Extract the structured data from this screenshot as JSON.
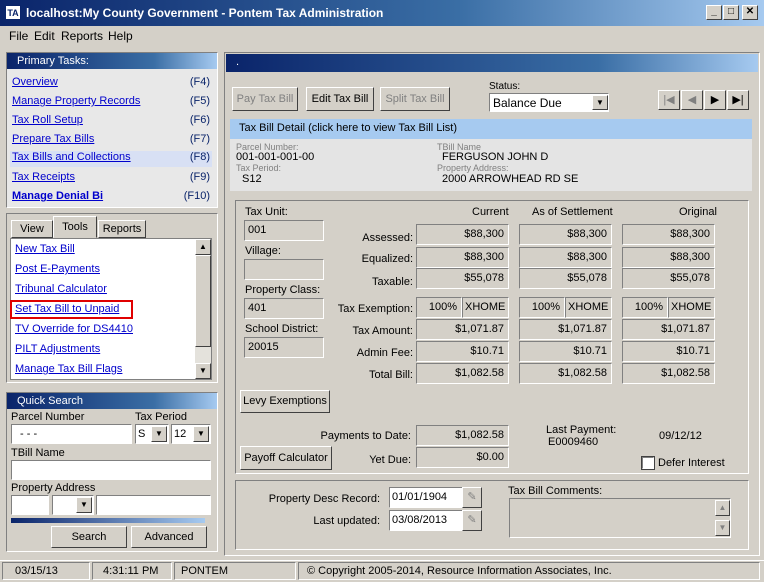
{
  "window": {
    "icon_text": "TA",
    "title": "localhost:My County Government - Pontem Tax Administration"
  },
  "menu": [
    "File",
    "Edit",
    "Reports",
    "Help"
  ],
  "primary_tasks": {
    "title": "Primary Tasks:",
    "items": [
      {
        "label": "Overview",
        "key": "(F4)"
      },
      {
        "label": "Manage Property Records",
        "key": "(F5)"
      },
      {
        "label": "Tax Roll Setup",
        "key": "(F6)"
      },
      {
        "label": "Prepare Tax Bills",
        "key": "(F7)"
      },
      {
        "label": "Tax Bills and Collections",
        "key": "(F8)"
      },
      {
        "label": "Tax Receipts",
        "key": "(F9)"
      },
      {
        "label": "Manage Denial Bi",
        "key": "(F10)"
      }
    ]
  },
  "tools_tabs": [
    "View",
    "Tools",
    "Reports"
  ],
  "tools_items": [
    "New Tax Bill",
    "Post E-Payments",
    "Tribunal Calculator",
    "Set Tax Bill to Unpaid",
    "TV Override for DS4410",
    "PILT Adjustments",
    "Manage Tax Bill Flags"
  ],
  "quick_search": {
    "title": "Quick Search",
    "parcel_label": "Parcel Number",
    "parcel_value": "-   -   -",
    "tax_period_label": "Tax Period",
    "tax_period_season": "S",
    "tax_period_year": "12",
    "tbill_name_label": "TBill Name",
    "property_address_label": "Property Address",
    "search_button": "Search",
    "advanced_button": "Advanced"
  },
  "status_bar": {
    "date": "03/15/13",
    "time": "4:31:11 PM",
    "user": "PONTEM",
    "copyright": "© Copyright 2005-2014, Resource Information Associates, Inc."
  },
  "right_panel": {
    "title": ".",
    "pay_button": "Pay Tax Bill",
    "edit_button": "Edit Tax Bill",
    "split_button": "Split Tax Bill",
    "status_label": "Status:",
    "status_value": "Balance Due",
    "detail_header": "Tax Bill Detail (click here to view Tax Bill List)",
    "parcel_number_label": "Parcel Number:",
    "parcel_number": "001-001-001-00",
    "tax_period_label": "Tax Period:",
    "tax_period": "S12",
    "tbill_name_label": "TBill Name",
    "tbill_name": "FERGUSON JOHN D",
    "property_address_label": "Property Address:",
    "property_address": "2000 ARROWHEAD RD SE"
  },
  "detail": {
    "tax_unit_label": "Tax Unit:",
    "tax_unit": "001",
    "village_label": "Village:",
    "village": "",
    "property_class_label": "Property Class:",
    "property_class": "401",
    "school_district_label": "School District:",
    "school_district": "20015",
    "col_headers": [
      "Current",
      "As of Settlement",
      "Original"
    ],
    "rows": [
      {
        "label": "Assessed:",
        "values": [
          "$88,300",
          "$88,300",
          "$88,300"
        ]
      },
      {
        "label": "Equalized:",
        "values": [
          "$88,300",
          "$88,300",
          "$88,300"
        ]
      },
      {
        "label": "Taxable:",
        "values": [
          "$55,078",
          "$55,078",
          "$55,078"
        ]
      }
    ],
    "exemption_label": "Tax Exemption:",
    "exemption": [
      {
        "pct": "100%",
        "code": "XHOME"
      },
      {
        "pct": "100%",
        "code": "XHOME"
      },
      {
        "pct": "100%",
        "code": "XHOME"
      }
    ],
    "rows2": [
      {
        "label": "Tax Amount:",
        "values": [
          "$1,071.87",
          "$1,071.87",
          "$1,071.87"
        ]
      },
      {
        "label": "Admin Fee:",
        "values": [
          "$10.71",
          "$10.71",
          "$10.71"
        ]
      },
      {
        "label": "Total Bill:",
        "values": [
          "$1,082.58",
          "$1,082.58",
          "$1,082.58"
        ]
      }
    ],
    "levy_button": "Levy Exemptions",
    "payments_label": "Payments to Date:",
    "payments": "$1,082.58",
    "yet_due_label": "Yet Due:",
    "yet_due": "$0.00",
    "payoff_button": "Payoff Calculator",
    "last_payment_label": "Last Payment:",
    "last_payment_id": "E0009460",
    "last_payment_date": "09/12/12",
    "defer_label": "Defer Interest"
  },
  "bottom": {
    "desc_label": "Property Desc Record:",
    "desc_value": "01/01/1904",
    "updated_label": "Last updated:",
    "updated_value": "03/08/2013",
    "comments_label": "Tax Bill Comments:"
  }
}
